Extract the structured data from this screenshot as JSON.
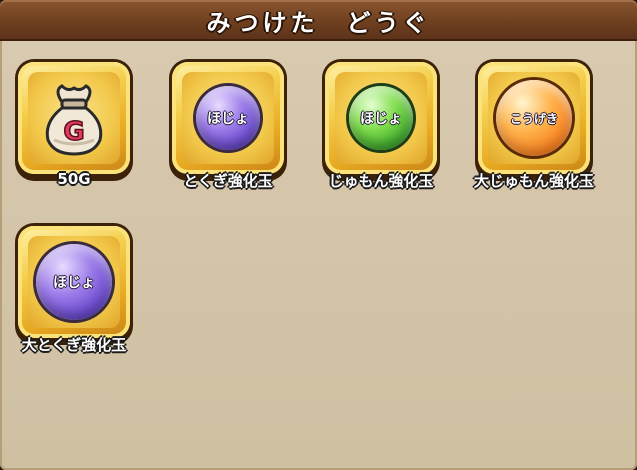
{
  "window": {
    "title": "みつけた　どうぐ"
  },
  "items": [
    {
      "label": "50G",
      "icon": "gold-bag-icon",
      "icon_text": "G"
    },
    {
      "label": "とくぎ強化玉",
      "icon": "purple-orb-icon",
      "icon_text": "ほじょ"
    },
    {
      "label": "じゅもん強化玉",
      "icon": "green-orb-icon",
      "icon_text": "ほじょ"
    },
    {
      "label": "大じゅもん強化玉",
      "icon": "orange-orb-icon",
      "icon_text": "こうげき"
    },
    {
      "label": "大とくぎ強化玉",
      "icon": "purple-orb-icon",
      "icon_text": "ほじょ"
    }
  ],
  "colors": {
    "title_bar": "#6e3f1f",
    "panel": "#d4c5a9",
    "tile": "#f2c84a"
  }
}
